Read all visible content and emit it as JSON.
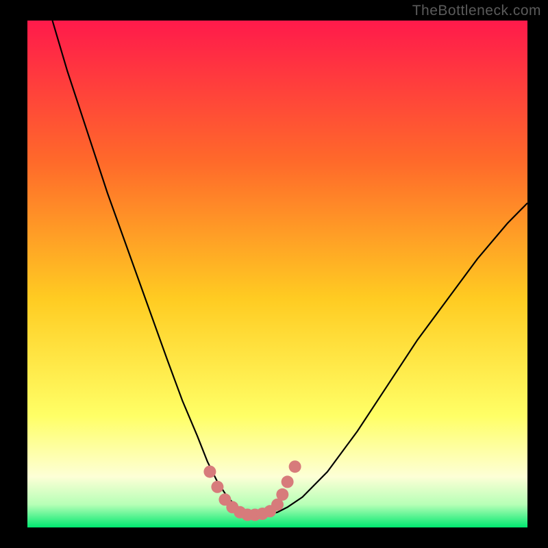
{
  "watermark": "TheBottleneck.com",
  "colors": {
    "bg": "#000000",
    "grad_top": "#ff1a4b",
    "grad_mid1": "#ff6a2a",
    "grad_mid2": "#ffcc22",
    "grad_mid3": "#ffff66",
    "grad_bottom_pale": "#fdffd6",
    "grad_green1": "#b6ffb6",
    "grad_green2": "#00e870",
    "curve_stroke": "#000000",
    "dot_fill": "#d77b7b"
  },
  "chart_data": {
    "type": "line",
    "title": "",
    "xlabel": "",
    "ylabel": "",
    "xlim": [
      0,
      100
    ],
    "ylim": [
      0,
      100
    ],
    "series": [
      {
        "name": "bottleneck-curve",
        "x": [
          5,
          8,
          12,
          16,
          20,
          24,
          28,
          31,
          34,
          36,
          38,
          40,
          42,
          44,
          46,
          48,
          50,
          52,
          55,
          60,
          66,
          72,
          78,
          84,
          90,
          96,
          100
        ],
        "y": [
          100,
          90,
          78,
          66,
          55,
          44,
          33,
          25,
          18,
          13,
          9,
          6,
          4,
          3,
          2.5,
          2.5,
          3,
          4,
          6,
          11,
          19,
          28,
          37,
          45,
          53,
          60,
          64
        ]
      }
    ],
    "highlight_points": {
      "name": "optimal-range-dots",
      "x": [
        36.5,
        38,
        39.5,
        41,
        42.5,
        44,
        45.5,
        47,
        48.5,
        50,
        51,
        52,
        53.5
      ],
      "y": [
        11,
        8,
        5.5,
        4,
        3,
        2.5,
        2.5,
        2.7,
        3.2,
        4.5,
        6.5,
        9,
        12
      ]
    }
  }
}
